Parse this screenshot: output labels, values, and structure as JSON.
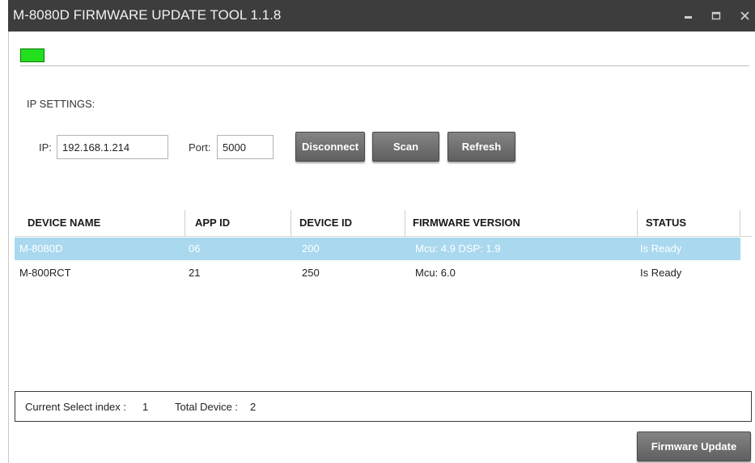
{
  "window": {
    "title": "M-8080D FIRMWARE UPDATE TOOL 1.1.8"
  },
  "status_led": {
    "color": "#22e01e",
    "state": "connected"
  },
  "ip_settings": {
    "section_label": "IP SETTINGS:",
    "ip_label": "IP:",
    "ip_value": "192.168.1.214",
    "port_label": "Port:",
    "port_value": "5000",
    "disconnect_label": "Disconnect",
    "scan_label": "Scan",
    "refresh_label": "Refresh"
  },
  "table": {
    "columns": [
      "DEVICE NAME",
      "APP ID",
      "DEVICE ID",
      "FIRMWARE VERSION",
      "STATUS"
    ],
    "rows": [
      {
        "device_name": "M-8080D",
        "app_id": "06",
        "device_id": "200",
        "firmware_version": "Mcu: 4.9 DSP: 1.9",
        "status": "Is Ready",
        "selected": true
      },
      {
        "device_name": "M-800RCT",
        "app_id": "21",
        "device_id": "250",
        "firmware_version": "Mcu: 6.0",
        "status": "Is Ready",
        "selected": false
      }
    ],
    "selected_row_color": "#a9d8ef"
  },
  "statusbar": {
    "current_select_label": "Current Select index :",
    "current_select_value": "1",
    "total_device_label": "Total Device :",
    "total_device_value": "2"
  },
  "actions": {
    "firmware_update_label": "Firmware Update"
  }
}
